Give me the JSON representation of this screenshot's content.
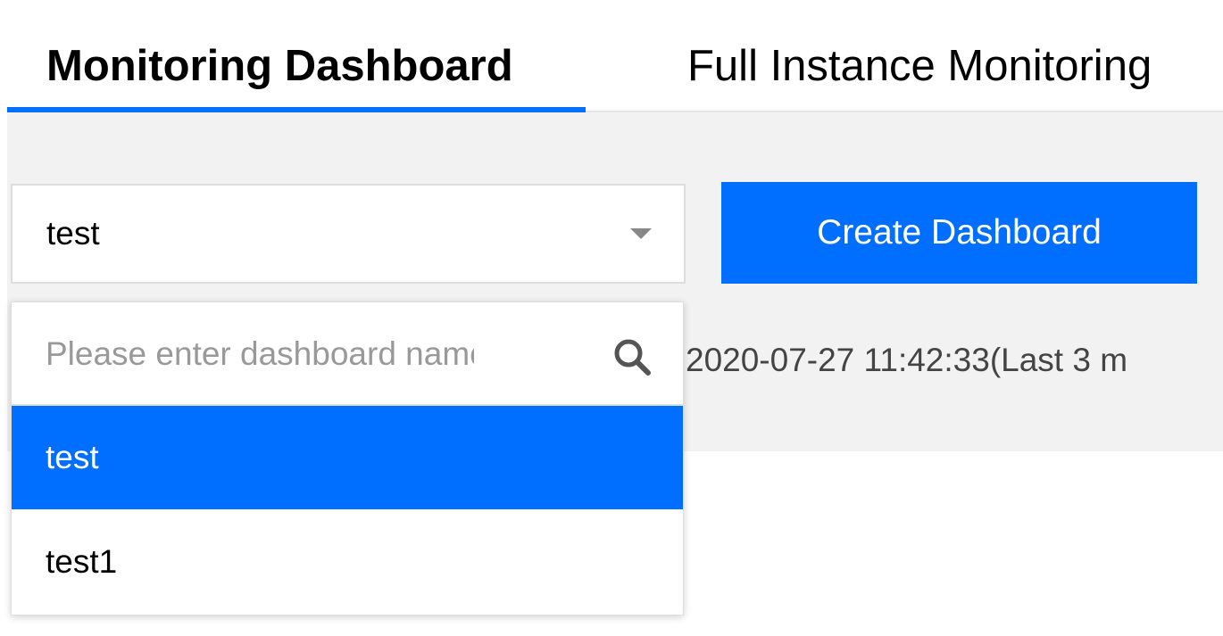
{
  "tabs": {
    "active_label": "Monitoring Dashboard",
    "inactive_label": "Full Instance Monitoring"
  },
  "dashboard_select": {
    "value": "test",
    "search_placeholder": "Please enter dashboard name",
    "options": [
      {
        "label": "test",
        "selected": true
      },
      {
        "label": "test1",
        "selected": false
      }
    ]
  },
  "create_button_label": "Create Dashboard",
  "timestamp_text": "2020-07-27 11:42:33(Last 3 m",
  "colors": {
    "accent": "#006eff",
    "panel_bg": "#f2f2f2",
    "border": "#dddddd"
  },
  "icons": {
    "search": "search-icon",
    "dropdown": "chevron-down-icon"
  }
}
